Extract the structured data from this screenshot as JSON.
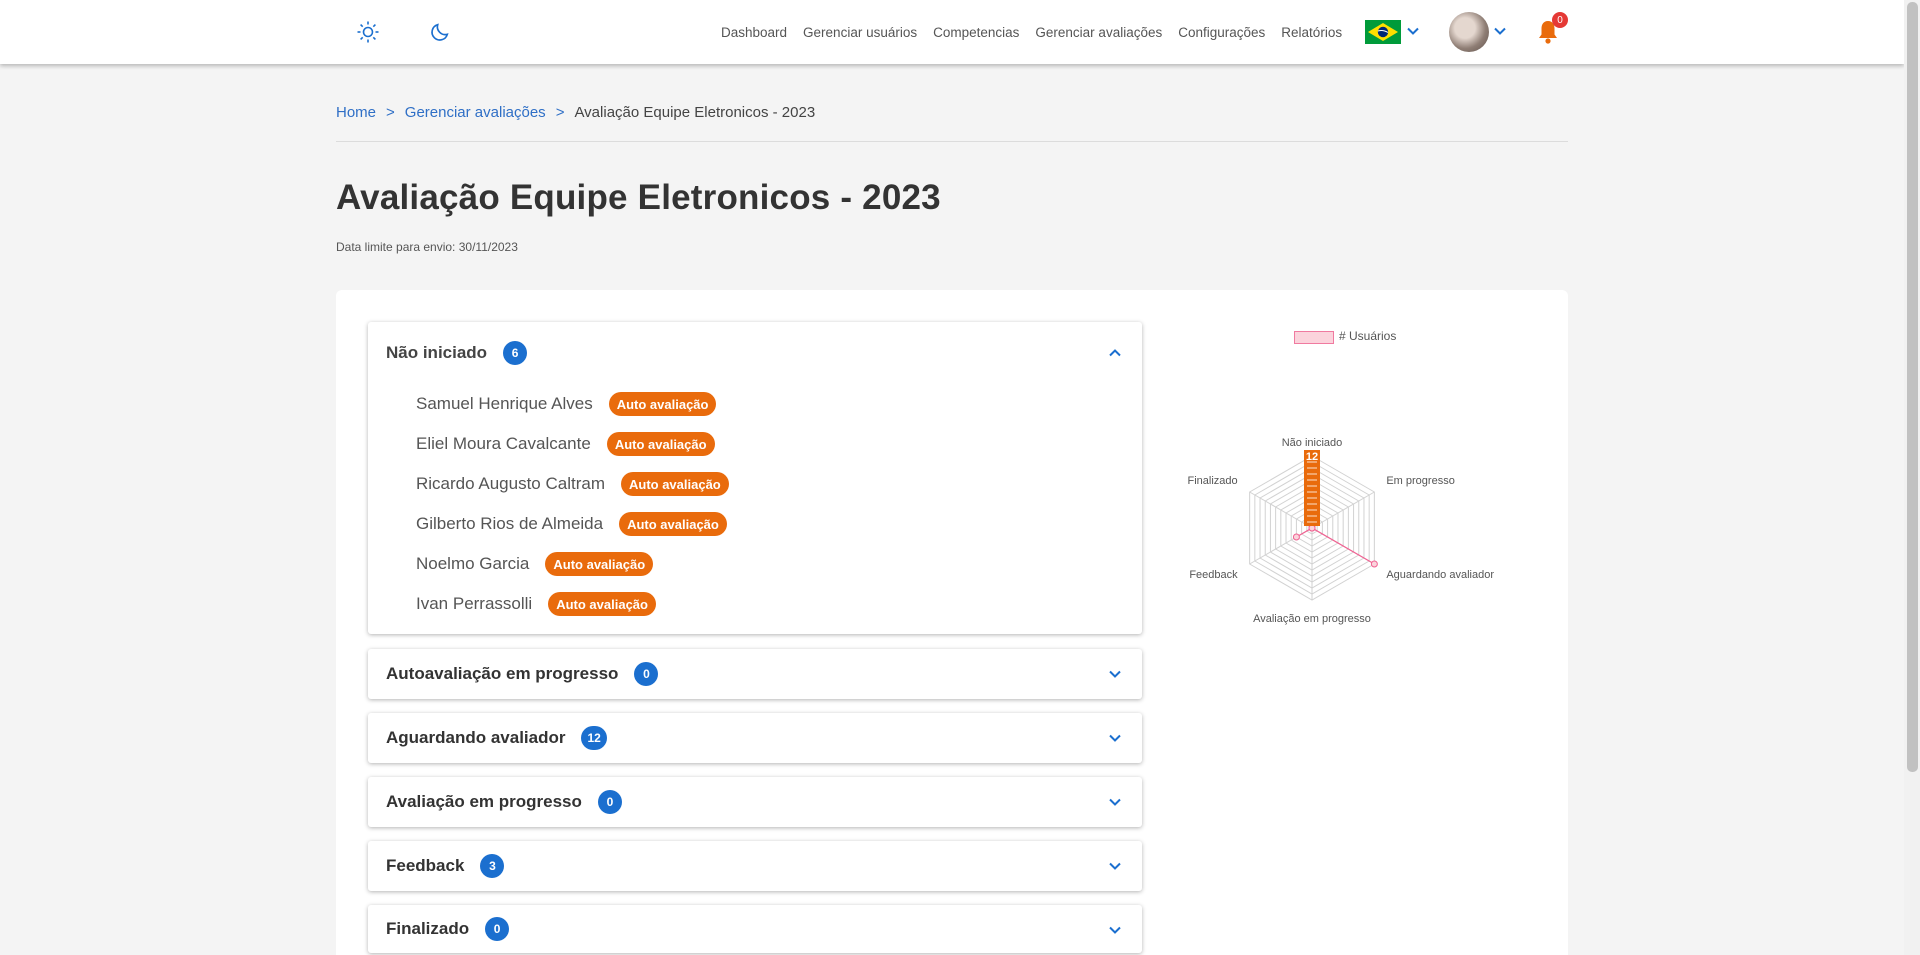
{
  "header": {
    "nav": [
      "Dashboard",
      "Gerenciar usuários",
      "Competencias",
      "Gerenciar avaliações",
      "Configurações",
      "Relatórios"
    ],
    "notifications_count": "0",
    "language_flag": "brazil-flag-icon"
  },
  "breadcrumb": {
    "home": "Home",
    "sep1": ">",
    "section": "Gerenciar avaliações",
    "sep2": ">",
    "current": "Avaliação Equipe Eletronicos - 2023"
  },
  "page": {
    "title": "Avaliação Equipe Eletronicos - 2023",
    "deadline": "Data limite para envio: 30/11/2023"
  },
  "accordions": [
    {
      "title": "Não iniciado",
      "count": "6",
      "expanded": true,
      "people": [
        {
          "name": "Samuel Henrique Alves",
          "tag": "Auto avaliação"
        },
        {
          "name": "Eliel Moura Cavalcante",
          "tag": "Auto avaliação"
        },
        {
          "name": "Ricardo Augusto Caltram",
          "tag": "Auto avaliação"
        },
        {
          "name": "Gilberto Rios de Almeida",
          "tag": "Auto avaliação"
        },
        {
          "name": "Noelmo Garcia",
          "tag": "Auto avaliação"
        },
        {
          "name": "Ivan Perrassolli",
          "tag": "Auto avaliação"
        }
      ]
    },
    {
      "title": "Autoavaliação em progresso",
      "count": "0"
    },
    {
      "title": "Aguardando avaliador",
      "count": "12"
    },
    {
      "title": "Avaliação em progresso",
      "count": "0"
    },
    {
      "title": "Feedback",
      "count": "3"
    },
    {
      "title": "Finalizado",
      "count": "0"
    }
  ],
  "chart_data": {
    "type": "radar",
    "legend": "# Usuários",
    "legend_position": "top",
    "axes": [
      "Não iniciado",
      "Em progresso",
      "Aguardando avaliador",
      "Avaliação em progresso",
      "Feedback",
      "Finalizado"
    ],
    "series": [
      {
        "name": "# Usuários",
        "values": [
          6,
          0,
          12,
          0,
          3,
          0
        ],
        "color": "#f06292",
        "fill": "#fbd3dc"
      }
    ],
    "scale_max": 12,
    "scale_label": "12",
    "rings": 12,
    "scale_color": "#e96b0c"
  },
  "colors": {
    "accent": "#1b6fcf",
    "tag": "#e96b0c",
    "bell": "#e96b0c",
    "badge": "#e53935"
  }
}
